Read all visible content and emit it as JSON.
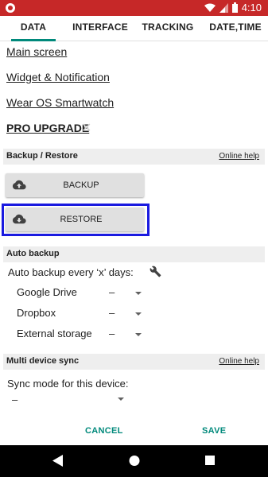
{
  "status_bar": {
    "time": "4:10"
  },
  "tabs": [
    {
      "label": "DATA",
      "active": true
    },
    {
      "label": "INTERFACE",
      "active": false
    },
    {
      "label": "TRACKING",
      "active": false
    },
    {
      "label": "DATE,TIME",
      "active": false
    }
  ],
  "links": {
    "main_screen": "Main screen",
    "widget": "Widget & Notification",
    "wear_os": "Wear OS Smartwatch",
    "pro_upgrade": "PRO UPGRADE"
  },
  "backup_restore": {
    "title": "Backup / Restore",
    "help": "Online help",
    "backup_label": "BACKUP",
    "restore_label": "RESTORE"
  },
  "auto_backup": {
    "title": "Auto backup",
    "every_label": "Auto backup every ‘x’ days:",
    "rows": [
      {
        "label": "Google Drive",
        "value": "–"
      },
      {
        "label": "Dropbox",
        "value": "–"
      },
      {
        "label": "External storage",
        "value": "–"
      }
    ]
  },
  "sync": {
    "title": "Multi device sync",
    "help": "Online help",
    "mode_label": "Sync mode for this device:",
    "mode_value": "–"
  },
  "actions": {
    "cancel": "CANCEL",
    "save": "SAVE"
  },
  "colors": {
    "status_bar": "#c62828",
    "accent": "#00897b",
    "focus_border": "#1a1ae0"
  }
}
